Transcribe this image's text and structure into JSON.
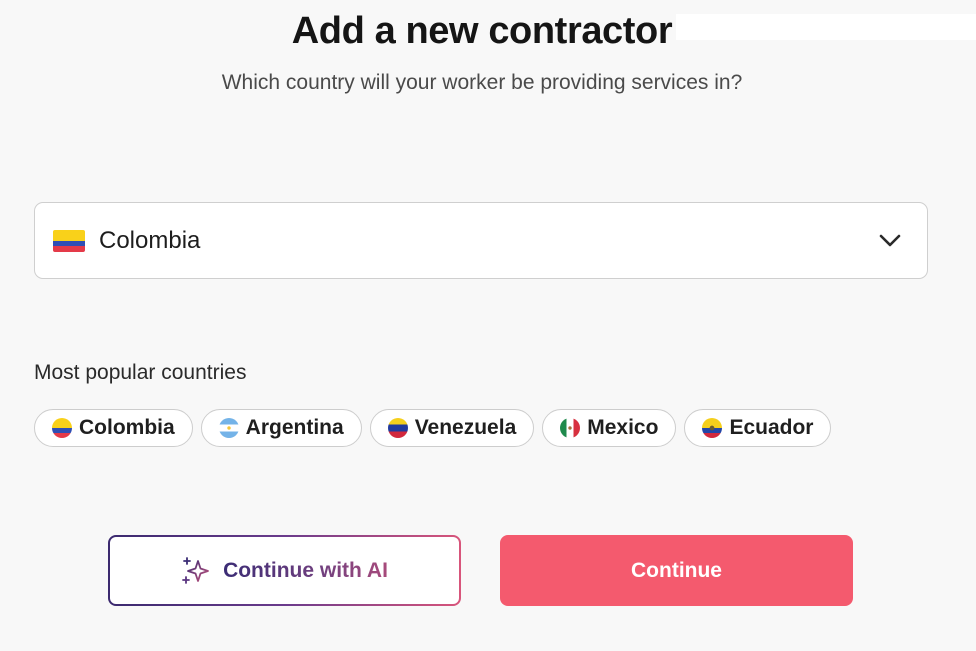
{
  "header": {
    "title": "Add a new contractor",
    "subtitle": "Which country will your worker be providing services in?"
  },
  "country_select": {
    "selected_value": "Colombia",
    "flag_icon": "colombia-flag-icon",
    "dropdown_icon": "chevron-down-icon"
  },
  "popular": {
    "label": "Most popular countries",
    "chips": [
      {
        "label": "Colombia",
        "flag_icon": "colombia-flag-icon"
      },
      {
        "label": "Argentina",
        "flag_icon": "argentina-flag-icon"
      },
      {
        "label": "Venezuela",
        "flag_icon": "venezuela-flag-icon"
      },
      {
        "label": "Mexico",
        "flag_icon": "mexico-flag-icon"
      },
      {
        "label": "Ecuador",
        "flag_icon": "ecuador-flag-icon"
      }
    ]
  },
  "actions": {
    "ai_button_label": "Continue with AI",
    "ai_icon": "sparkles-icon",
    "continue_label": "Continue"
  },
  "colors": {
    "primary": "#f45a6e",
    "ai_gradient_start": "#3b2a6f",
    "ai_gradient_end": "#d8557b",
    "background": "#f8f8f8"
  }
}
